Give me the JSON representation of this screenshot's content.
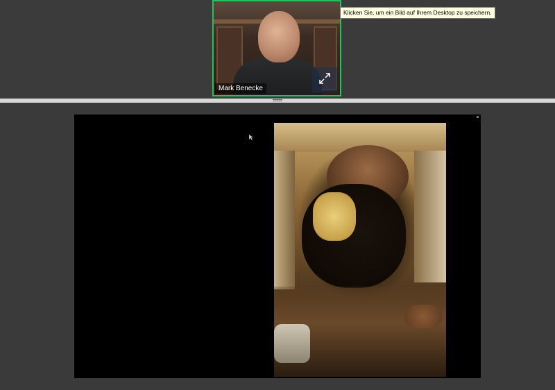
{
  "video_tile": {
    "participant_name": "Mark Benecke"
  },
  "tooltip": {
    "text": "Klicken Sie, um ein Bild auf Ihrem Desktop zu speichern."
  },
  "icons": {
    "expand": "expand-arrows-icon",
    "divider_handle": "drag-handle-icon",
    "cursor": "mouse-cursor-icon"
  },
  "colors": {
    "active_speaker_border": "#23c15f",
    "background": "#3a3a3a",
    "tooltip_bg": "#ffffe1"
  }
}
